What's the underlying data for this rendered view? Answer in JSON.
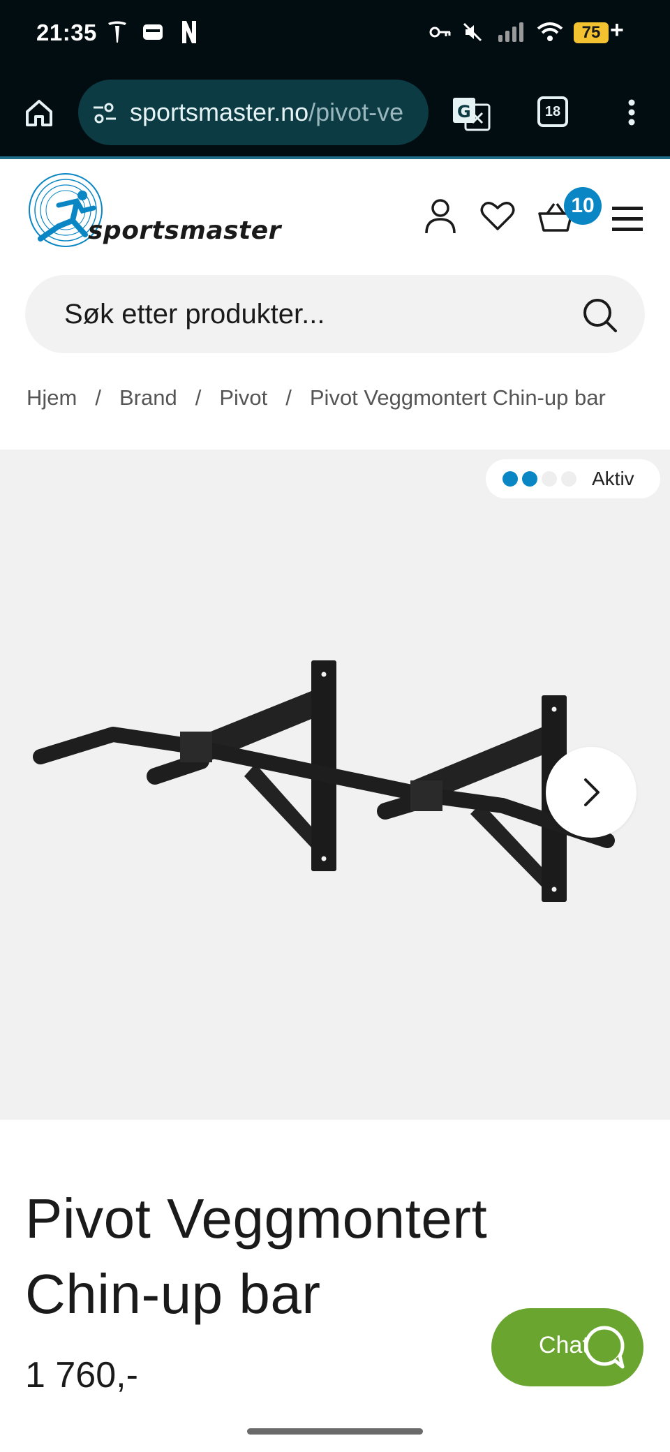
{
  "status_bar": {
    "time": "21:35",
    "battery_percent": "75",
    "battery_charging": "+",
    "icons": [
      "tesla-icon",
      "wallet-icon",
      "netflix-icon",
      "vpn-key-icon",
      "mute-icon",
      "signal-icon",
      "wifi-icon"
    ]
  },
  "browser": {
    "url_domain": "sportsmaster.no",
    "url_path": "/pivot-ve",
    "tabs_count": "18",
    "icons": [
      "home-icon",
      "site-settings-icon",
      "translate-icon",
      "tabs-icon",
      "more-menu-icon"
    ]
  },
  "header": {
    "logo_text": "sportsmaster",
    "cart_count": "10",
    "brand_color": "#0a86c4",
    "icons": [
      "account-icon",
      "wishlist-heart-icon",
      "cart-basket-icon",
      "menu-hamburger-icon"
    ]
  },
  "search": {
    "placeholder": "Søk etter produkter..."
  },
  "breadcrumb": [
    "Hjem",
    "Brand",
    "Pivot",
    "Pivot Veggmontert Chin-up bar"
  ],
  "gallery": {
    "stock_label": "Aktiv",
    "stock_dots_filled": 2,
    "stock_dots_total": 4,
    "background": "#f1f1f1"
  },
  "product": {
    "title_line1": "Pivot Veggmontert",
    "title_line2": "Chin-up bar",
    "price": "1 760,-"
  },
  "chat": {
    "label": "Chat",
    "color": "#6aa530"
  }
}
